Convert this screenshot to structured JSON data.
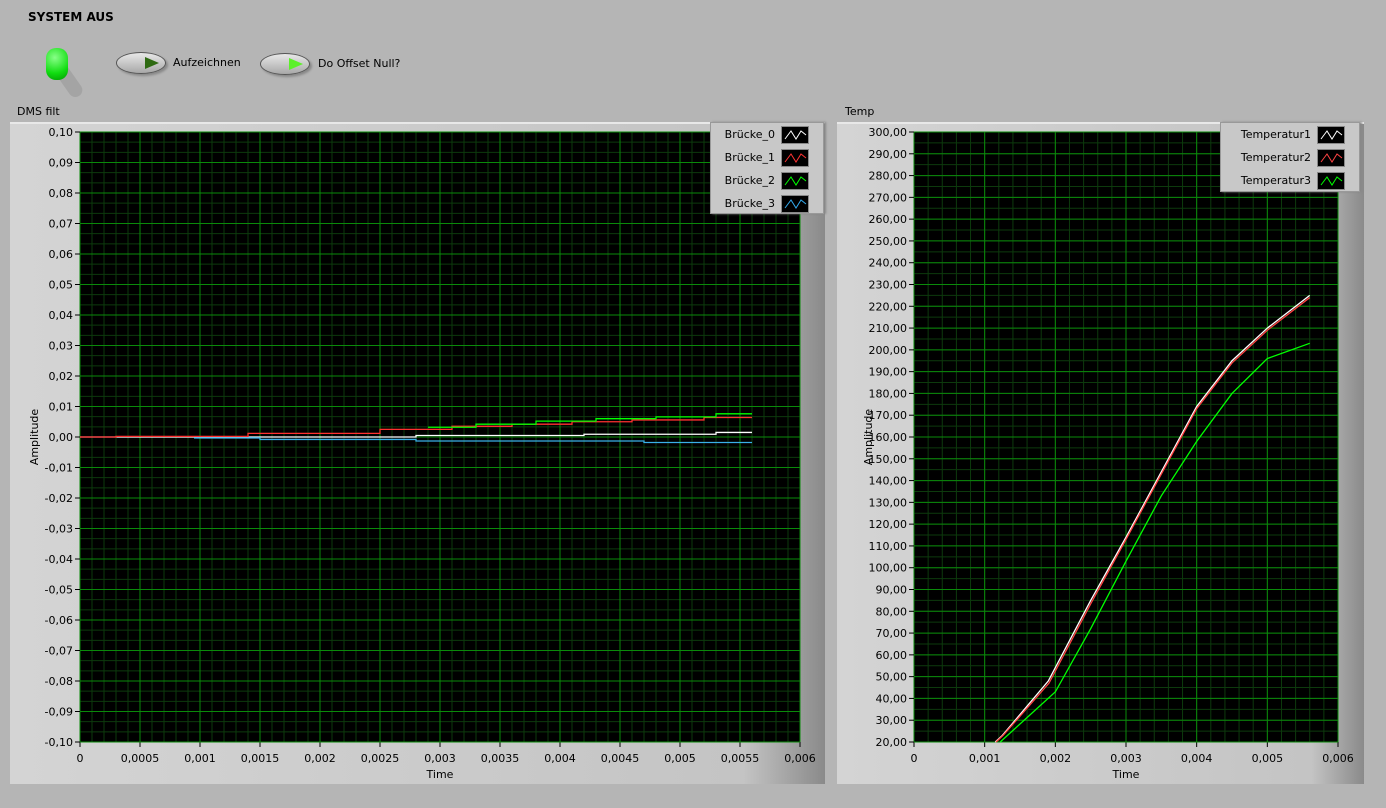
{
  "title": "SYSTEM AUS",
  "buttons": {
    "record": "Aufzeichnen",
    "offset": "Do Offset Null?"
  },
  "charts": [
    {
      "name": "dms",
      "label": "DMS filt",
      "xlabel": "Time",
      "ylabel": "Amplitude",
      "xlim": [
        0,
        0.006
      ],
      "ylim": [
        -0.1,
        0.1
      ],
      "xticks": [
        "0",
        "0,0005",
        "0,001",
        "0,0015",
        "0,002",
        "0,0025",
        "0,003",
        "0,0035",
        "0,004",
        "0,0045",
        "0,005",
        "0,0055",
        "0,006"
      ],
      "yticks": [
        "0,10",
        "0,09",
        "0,08",
        "0,07",
        "0,06",
        "0,05",
        "0,04",
        "0,03",
        "0,02",
        "0,01",
        "0,00",
        "-0,01",
        "-0,02",
        "-0,03",
        "-0,04",
        "-0,05",
        "-0,06",
        "-0,07",
        "-0,08",
        "-0,09",
        "-0,10"
      ],
      "series": [
        {
          "name": "Brücke_0",
          "color": "#ffffff",
          "step": true,
          "x": [
            0,
            0.0028,
            0.0042,
            0.0053,
            0.0056
          ],
          "y": [
            0,
            0.0005,
            0.0009,
            0.0015,
            0.0015
          ]
        },
        {
          "name": "Brücke_1",
          "color": "#ff3030",
          "step": true,
          "x": [
            0,
            0.0003,
            0.0014,
            0.0025,
            0.0031,
            0.0036,
            0.0041,
            0.0046,
            0.0052,
            0.0056
          ],
          "y": [
            0,
            0.0002,
            0.0012,
            0.0025,
            0.0035,
            0.0042,
            0.005,
            0.0056,
            0.0064,
            0.0064
          ]
        },
        {
          "name": "Brücke_2",
          "color": "#00ff00",
          "step": true,
          "x": [
            0.0029,
            0.0033,
            0.0038,
            0.0043,
            0.0048,
            0.0053,
            0.0056
          ],
          "y": [
            0.0032,
            0.0042,
            0.0052,
            0.006,
            0.0066,
            0.0076,
            0.0076
          ]
        },
        {
          "name": "Brücke_3",
          "color": "#3ab0e8",
          "step": true,
          "x": [
            0.00095,
            0.0015,
            0.0028,
            0.0047,
            0.0056
          ],
          "y": [
            -0.0003,
            -0.0008,
            -0.0013,
            -0.0018,
            -0.0018
          ]
        }
      ]
    },
    {
      "name": "temp",
      "label": "Temp",
      "xlabel": "Time",
      "ylabel": "Amplitude",
      "xlim": [
        0,
        0.006
      ],
      "ylim": [
        20,
        300
      ],
      "xticks": [
        "0",
        "0,001",
        "0,002",
        "0,003",
        "0,004",
        "0,005",
        "0,006"
      ],
      "yticks": [
        "300,00",
        "290,00",
        "280,00",
        "270,00",
        "260,00",
        "250,00",
        "240,00",
        "230,00",
        "220,00",
        "210,00",
        "200,00",
        "190,00",
        "180,00",
        "170,00",
        "160,00",
        "150,00",
        "140,00",
        "130,00",
        "120,00",
        "110,00",
        "100,00",
        "90,00",
        "80,00",
        "70,00",
        "60,00",
        "50,00",
        "40,00",
        "30,00",
        "20,00"
      ],
      "series": [
        {
          "name": "Temperatur1",
          "color": "#ffffff",
          "x": [
            0.00115,
            0.00125,
            0.0019,
            0.0025,
            0.003,
            0.0035,
            0.004,
            0.0045,
            0.005,
            0.0056
          ],
          "y": [
            20,
            23,
            48,
            85,
            114,
            144,
            174,
            195,
            210,
            225
          ]
        },
        {
          "name": "Temperatur2",
          "color": "#ff4040",
          "x": [
            0.00116,
            0.00126,
            0.00191,
            0.00251,
            0.003,
            0.0035,
            0.004,
            0.0045,
            0.005,
            0.0056
          ],
          "y": [
            20,
            23,
            47,
            84,
            113,
            143,
            173,
            194,
            209,
            224
          ]
        },
        {
          "name": "Temperatur3",
          "color": "#00ff00",
          "x": [
            0.00122,
            0.002,
            0.0025,
            0.003,
            0.0035,
            0.004,
            0.0045,
            0.005,
            0.0056
          ],
          "y": [
            20,
            43,
            72,
            103,
            133,
            158,
            180,
            196,
            203
          ]
        }
      ]
    }
  ]
}
